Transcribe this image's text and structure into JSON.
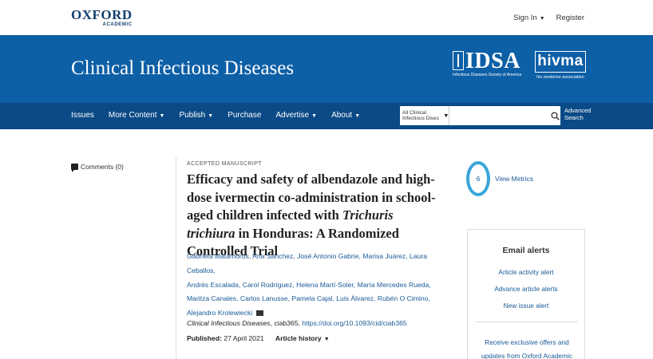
{
  "topbar": {
    "logo_main": "OXFORD",
    "logo_sub": "ACADEMIC",
    "sign_in": "Sign In",
    "register": "Register"
  },
  "banner": {
    "journal_title": "Clinical Infectious Diseases",
    "idsa_logo": "IDSA",
    "idsa_tagline": "Infectious Diseases Society of America",
    "hivma_logo": "hivma",
    "hivma_tagline": "hiv medicine association"
  },
  "nav": {
    "items": [
      "Issues",
      "More Content",
      "Publish",
      "Purchase",
      "Advertise",
      "About"
    ],
    "search_scope": "All Clinical Infectious Dises",
    "search_placeholder": "",
    "advanced_search": "Advanced Search"
  },
  "sidebar": {
    "comments": "Comments (0)"
  },
  "article": {
    "label": "ACCEPTED MANUSCRIPT",
    "title_part1": "Efficacy and safety of albendazole and high-dose ivermectin co-administration in school-aged children infected with ",
    "title_italic": "Trichuris trichiura",
    "title_part2": " in Honduras: A Randomized Controlled Trial",
    "authors": [
      "Gabriela Matamoros",
      "Ana Sánchez",
      "José Antonio Gabrie",
      "Marisa Juárez",
      "Laura Ceballos",
      "Andrés Escalada",
      "Carol Rodríguez",
      "Helena Martí-Soler",
      "María Mercedes Rueda",
      "Maritza Canales",
      "Carlos Lanusse",
      "Pamela Cajal",
      "Luis Álvarez",
      "Rubén O Cimino",
      "Alejandro Krolewiecki"
    ],
    "journal_name": "Clinical Infectious Diseases",
    "citation_id": ", ciab365, ",
    "doi": "https://doi.org/10.1093/cid/ciab365",
    "published_label": "Published:",
    "published_date": "27 April 2021",
    "article_history": "Article history"
  },
  "metrics": {
    "count": "6",
    "view_metrics": "View Metrics"
  },
  "alerts": {
    "title": "Email alerts",
    "links": [
      "Article activity alert",
      "Advance article alerts",
      "New issue alert"
    ],
    "offers": "Receive exclusive offers and updates from Oxford Academic"
  },
  "colors": {
    "banner": "#0d5fa6",
    "navbar": "#0a4a86",
    "link": "#1a5a96",
    "metric_ring": "#3aa6d9"
  }
}
